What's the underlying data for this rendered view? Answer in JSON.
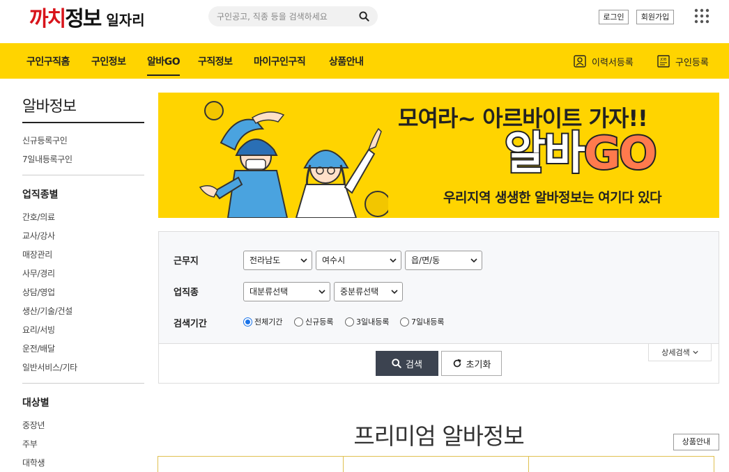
{
  "header": {
    "logo_part1": "까치",
    "logo_part2": "정보",
    "logo_sub": "일자리",
    "search_placeholder": "구인공고, 직종 등을 검색하세요",
    "login_label": "로그인",
    "join_label": "회원가입"
  },
  "nav": {
    "items": [
      "구인구직홈",
      "구인정보",
      "알바GO",
      "구직정보",
      "마이구인구직",
      "상품안내"
    ],
    "active_index": 2,
    "resume_register": "이력서등록",
    "job_register": "구인등록",
    "accent_color": "#ffd400"
  },
  "sidebar": {
    "title": "알바정보",
    "top_links": [
      "신규등록구인",
      "7일내등록구인"
    ],
    "group1_title": "업직종별",
    "group1_links": [
      "간호/의료",
      "교사/강사",
      "매장관리",
      "사무/경리",
      "상담/영업",
      "생산/기술/건설",
      "요리/서빙",
      "운전/배달",
      "일반서비스/기타"
    ],
    "group2_title": "대상별",
    "group2_links": [
      "중장년",
      "주부",
      "대학생"
    ]
  },
  "banner": {
    "headline": "모여라~ 아르바이트 가자!!",
    "big_text_k": "알바",
    "big_text_go": "GO",
    "subtext": "우리지역 생생한 알바정보는 여기다 있다"
  },
  "search_form": {
    "location_label": "근무지",
    "location_values": [
      "전라남도",
      "여수시",
      "읍/면/동"
    ],
    "job_label": "업직종",
    "job_values": [
      "대분류선택",
      "중분류선택"
    ],
    "period_label": "검색기간",
    "period_options": [
      "전체기간",
      "신규등록",
      "3일내등록",
      "7일내등록"
    ],
    "period_selected": 0,
    "detail_search": "상세검색",
    "search_button": "검색",
    "reset_button": "초기화"
  },
  "premium": {
    "title": "프리미엄 알바정보",
    "product_button": "상품안내"
  }
}
